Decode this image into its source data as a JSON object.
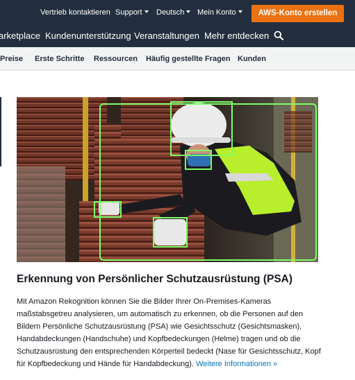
{
  "topbar": {
    "contact": "Vertrieb kontaktieren",
    "support": "Support",
    "language": "Deutsch",
    "account": "Mein Konto",
    "create_account": "AWS-Konto erstellen"
  },
  "mainnav": {
    "items": [
      "arketplace",
      "Kundenunterstützung",
      "Veranstaltungen",
      "Mehr entdecken"
    ],
    "icon": "search-icon"
  },
  "subnav": {
    "items": [
      "Preise",
      "Erste Schritte",
      "Ressourcen",
      "Häufig gestellte Fragen",
      "Kunden"
    ]
  },
  "section": {
    "title": "Erkennung von Persönlicher Schutzausrüstung (PSA)",
    "lines": [
      "Mit Amazon Rekognition können Sie die Bilder Ihrer On-Premises-Kameras",
      "maßstabsgetreu analysieren, um automatisch zu erkennen, ob die Personen auf den",
      "Bildern Persönliche Schutzausrüstung (PSA) wie Gesichtsschutz (Gesichtsmasken),",
      "Handabdeckungen (Handschuhe) und Kopfbedeckungen (Helme) tragen und ob die",
      "Schutzausrüstung den entsprechenden Körperteil bedeckt (Nase für Gesichtsschutz, Kopf",
      "für Kopfbedeckung und Hände für Handabdeckung)."
    ],
    "link": "Weitere Informationen »"
  },
  "colors": {
    "nav_bg": "#232f3e",
    "cta": "#ec7211",
    "link": "#0073bb",
    "detection_box": "#7dff6a"
  }
}
